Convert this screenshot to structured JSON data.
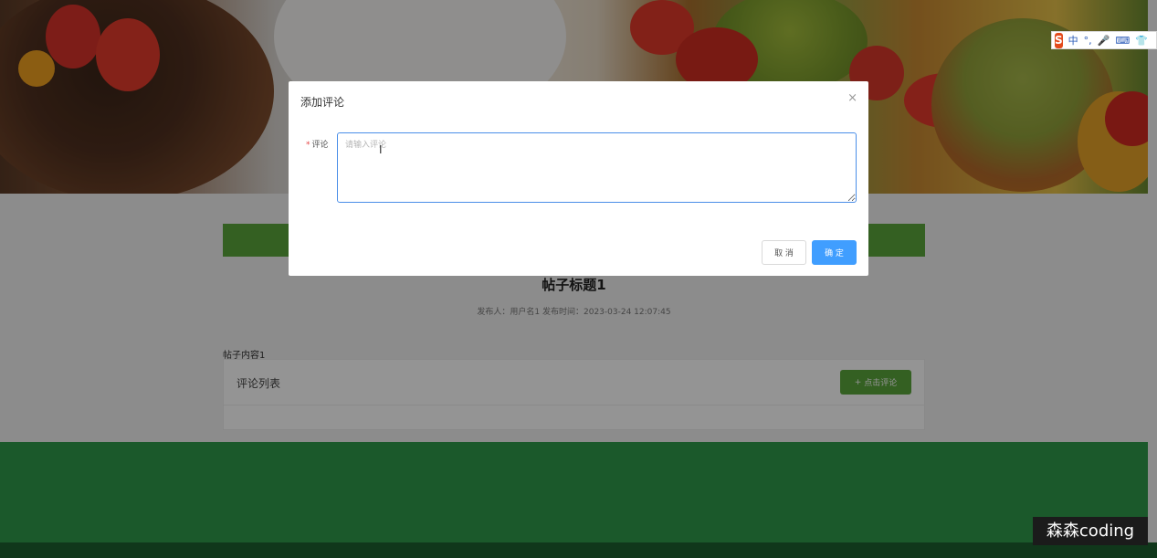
{
  "ime_toolbar": {
    "logo": "S",
    "mode": "中",
    "items": [
      "°,",
      "🎤",
      "⌨",
      "👕",
      "⋮"
    ]
  },
  "post": {
    "title": "帖子标题1",
    "meta": "发布人：用户名1  发布时间：2023-03-24 12:07:45",
    "content": "帖子内容1"
  },
  "comments": {
    "title": "评论列表",
    "add_button": "点击评论",
    "add_icon": "plus-icon"
  },
  "dialog": {
    "title": "添加评论",
    "close": "×",
    "field_label": "评论",
    "required_mark": "*",
    "placeholder": "请输入评论",
    "value": "",
    "cancel_label": "取 消",
    "confirm_label": "确 定"
  },
  "watermark": "森森coding",
  "colors": {
    "primary": "#409eff",
    "brand_green": "#5aa53c",
    "footer_green": "#2f9a4a"
  }
}
